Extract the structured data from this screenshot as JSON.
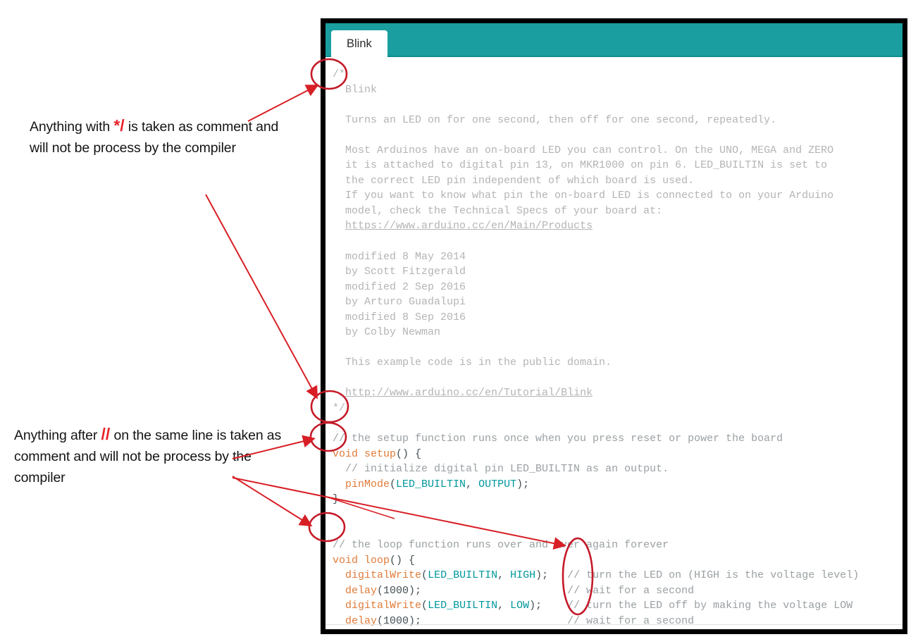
{
  "window": {
    "tab_label": "Blink",
    "toolbar_color": "#1a9e9f",
    "frame_color": "#000000"
  },
  "annotations": {
    "accent_color": "#e8232a",
    "callout_1": {
      "part_before": "Anything with ",
      "symbol": "*/",
      "part_after": " is taken as comment and will not be process by the compiler"
    },
    "callout_2": {
      "part_before": "Anything after ",
      "symbol": "//",
      "part_after": " on the same line is taken as comment and will not be process by the compiler"
    },
    "ellipse_targets": [
      "block-comment-open",
      "block-comment-close",
      "setup-line-comment",
      "loop-line-comment",
      "trailing-line-comments"
    ]
  },
  "code": {
    "language": "arduino",
    "lines": [
      {
        "type": "block-comment",
        "text": "/*"
      },
      {
        "type": "block-comment",
        "text": "  Blink"
      },
      {
        "type": "block-comment",
        "text": ""
      },
      {
        "type": "block-comment",
        "text": "  Turns an LED on for one second, then off for one second, repeatedly."
      },
      {
        "type": "block-comment",
        "text": ""
      },
      {
        "type": "block-comment",
        "text": "  Most Arduinos have an on-board LED you can control. On the UNO, MEGA and ZERO"
      },
      {
        "type": "block-comment",
        "text": "  it is attached to digital pin 13, on MKR1000 on pin 6. LED_BUILTIN is set to"
      },
      {
        "type": "block-comment",
        "text": "  the correct LED pin independent of which board is used."
      },
      {
        "type": "block-comment",
        "text": "  If you want to know what pin the on-board LED is connected to on your Arduino"
      },
      {
        "type": "block-comment",
        "text": "  model, check the Technical Specs of your board at:"
      },
      {
        "type": "block-comment-url",
        "text": "  https://www.arduino.cc/en/Main/Products"
      },
      {
        "type": "block-comment",
        "text": ""
      },
      {
        "type": "block-comment",
        "text": "  modified 8 May 2014"
      },
      {
        "type": "block-comment",
        "text": "  by Scott Fitzgerald"
      },
      {
        "type": "block-comment",
        "text": "  modified 2 Sep 2016"
      },
      {
        "type": "block-comment",
        "text": "  by Arturo Guadalupi"
      },
      {
        "type": "block-comment",
        "text": "  modified 8 Sep 2016"
      },
      {
        "type": "block-comment",
        "text": "  by Colby Newman"
      },
      {
        "type": "block-comment",
        "text": ""
      },
      {
        "type": "block-comment",
        "text": "  This example code is in the public domain."
      },
      {
        "type": "block-comment",
        "text": ""
      },
      {
        "type": "block-comment-url",
        "text": "  http://www.arduino.cc/en/Tutorial/Blink"
      },
      {
        "type": "block-comment",
        "text": "*/"
      },
      {
        "type": "blank",
        "text": ""
      },
      {
        "type": "line-comment",
        "text": "// the setup function runs once when you press reset or power the board"
      },
      {
        "type": "code",
        "text": "void setup() {"
      },
      {
        "type": "line-comment-indent",
        "text": "  // initialize digital pin LED_BUILTIN as an output."
      },
      {
        "type": "code",
        "text": "  pinMode(LED_BUILTIN, OUTPUT);"
      },
      {
        "type": "code",
        "text": "}"
      },
      {
        "type": "blank",
        "text": ""
      },
      {
        "type": "blank",
        "text": ""
      },
      {
        "type": "line-comment",
        "text": "// the loop function runs over and over again forever"
      },
      {
        "type": "code",
        "text": "void loop() {"
      },
      {
        "type": "code",
        "text": "  digitalWrite(LED_BUILTIN, HIGH);   // turn the LED on (HIGH is the voltage level)"
      },
      {
        "type": "code",
        "text": "  delay(1000);                       // wait for a second"
      },
      {
        "type": "code",
        "text": "  digitalWrite(LED_BUILTIN, LOW);    // turn the LED off by making the voltage LOW"
      },
      {
        "type": "code",
        "text": "  delay(1000);                       // wait for a second"
      },
      {
        "type": "code",
        "text": "}"
      }
    ],
    "tokens": {
      "keywords": [
        "void"
      ],
      "functions": [
        "setup",
        "loop",
        "pinMode",
        "digitalWrite",
        "delay"
      ],
      "constants": [
        "LED_BUILTIN",
        "OUTPUT",
        "HIGH",
        "LOW"
      ],
      "numbers": [
        "1000",
        "13",
        "6"
      ],
      "trailing_comments": [
        "// turn the LED on (HIGH is the voltage level)",
        "// wait for a second",
        "// turn the LED off by making the voltage LOW",
        "// wait for a second"
      ]
    },
    "colors": {
      "block_comment": "#b4b4b4",
      "line_comment": "#9aa0a3",
      "keyword": "#e07b39",
      "function": "#df7a2c",
      "constant": "#00979c",
      "plain": "#434f54"
    }
  }
}
